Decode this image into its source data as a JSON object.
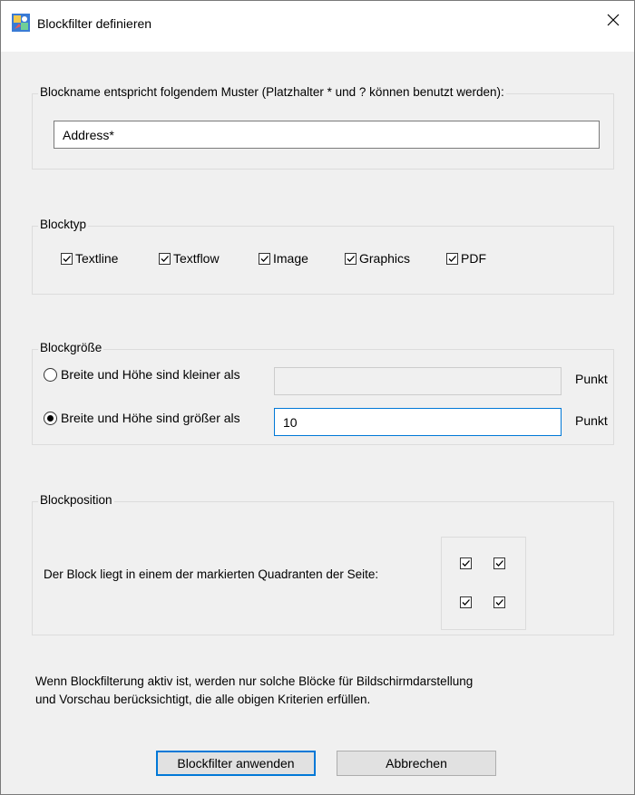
{
  "window": {
    "title": "Blockfilter definieren",
    "close_glyph": "✕"
  },
  "name_group": {
    "label": "Blockname entspricht folgendem Muster (Platzhalter * und ? können benutzt werden):",
    "pattern_value": "Address*"
  },
  "type_group": {
    "label": "Blocktyp",
    "items": [
      {
        "label": "Textline",
        "checked": true
      },
      {
        "label": "Textflow",
        "checked": true
      },
      {
        "label": "Image",
        "checked": true
      },
      {
        "label": "Graphics",
        "checked": true
      },
      {
        "label": "PDF",
        "checked": true
      }
    ]
  },
  "size_group": {
    "label": "Blockgröße",
    "option_smaller": {
      "label": "Breite und Höhe sind kleiner als",
      "selected": false,
      "value": "",
      "unit": "Punkt"
    },
    "option_larger": {
      "label": "Breite und Höhe sind größer als",
      "selected": true,
      "value": "10",
      "unit": "Punkt"
    }
  },
  "position_group": {
    "label": "Blockposition",
    "description": "Der Block liegt in einem der markierten Quadranten der Seite:",
    "quadrants": {
      "top_left": true,
      "top_right": true,
      "bottom_left": true,
      "bottom_right": true
    }
  },
  "info_text": {
    "line1": "Wenn Blockfilterung aktiv ist, werden nur solche Blöcke für Bildschirmdarstellung",
    "line2": "und Vorschau berücksichtigt, die alle obigen Kriterien erfüllen."
  },
  "buttons": {
    "apply": "Blockfilter anwenden",
    "cancel": "Abbrechen"
  },
  "colors": {
    "dialog_bg": "#f0f0f0",
    "focus_accent": "#0078d7"
  },
  "icons": {
    "app": "blockfilter-app-icon",
    "close": "close-icon",
    "check": "checkmark-icon"
  }
}
